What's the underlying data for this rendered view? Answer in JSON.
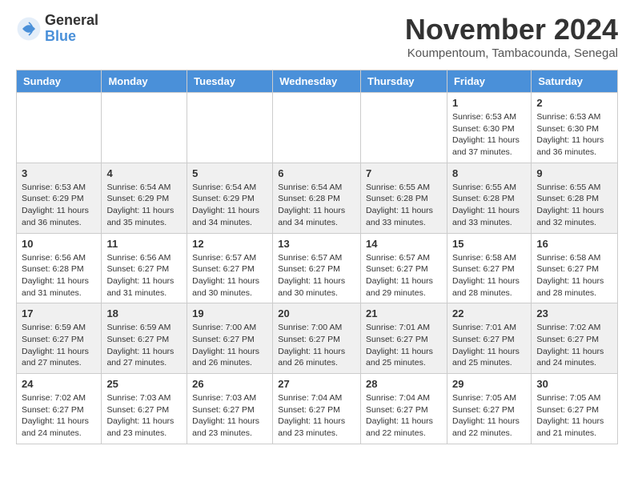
{
  "logo": {
    "general": "General",
    "blue": "Blue"
  },
  "header": {
    "month": "November 2024",
    "location": "Koumpentoum, Tambacounda, Senegal"
  },
  "weekdays": [
    "Sunday",
    "Monday",
    "Tuesday",
    "Wednesday",
    "Thursday",
    "Friday",
    "Saturday"
  ],
  "weeks": [
    [
      {
        "day": "",
        "info": ""
      },
      {
        "day": "",
        "info": ""
      },
      {
        "day": "",
        "info": ""
      },
      {
        "day": "",
        "info": ""
      },
      {
        "day": "",
        "info": ""
      },
      {
        "day": "1",
        "info": "Sunrise: 6:53 AM\nSunset: 6:30 PM\nDaylight: 11 hours and 37 minutes."
      },
      {
        "day": "2",
        "info": "Sunrise: 6:53 AM\nSunset: 6:30 PM\nDaylight: 11 hours and 36 minutes."
      }
    ],
    [
      {
        "day": "3",
        "info": "Sunrise: 6:53 AM\nSunset: 6:29 PM\nDaylight: 11 hours and 36 minutes."
      },
      {
        "day": "4",
        "info": "Sunrise: 6:54 AM\nSunset: 6:29 PM\nDaylight: 11 hours and 35 minutes."
      },
      {
        "day": "5",
        "info": "Sunrise: 6:54 AM\nSunset: 6:29 PM\nDaylight: 11 hours and 34 minutes."
      },
      {
        "day": "6",
        "info": "Sunrise: 6:54 AM\nSunset: 6:28 PM\nDaylight: 11 hours and 34 minutes."
      },
      {
        "day": "7",
        "info": "Sunrise: 6:55 AM\nSunset: 6:28 PM\nDaylight: 11 hours and 33 minutes."
      },
      {
        "day": "8",
        "info": "Sunrise: 6:55 AM\nSunset: 6:28 PM\nDaylight: 11 hours and 33 minutes."
      },
      {
        "day": "9",
        "info": "Sunrise: 6:55 AM\nSunset: 6:28 PM\nDaylight: 11 hours and 32 minutes."
      }
    ],
    [
      {
        "day": "10",
        "info": "Sunrise: 6:56 AM\nSunset: 6:28 PM\nDaylight: 11 hours and 31 minutes."
      },
      {
        "day": "11",
        "info": "Sunrise: 6:56 AM\nSunset: 6:27 PM\nDaylight: 11 hours and 31 minutes."
      },
      {
        "day": "12",
        "info": "Sunrise: 6:57 AM\nSunset: 6:27 PM\nDaylight: 11 hours and 30 minutes."
      },
      {
        "day": "13",
        "info": "Sunrise: 6:57 AM\nSunset: 6:27 PM\nDaylight: 11 hours and 30 minutes."
      },
      {
        "day": "14",
        "info": "Sunrise: 6:57 AM\nSunset: 6:27 PM\nDaylight: 11 hours and 29 minutes."
      },
      {
        "day": "15",
        "info": "Sunrise: 6:58 AM\nSunset: 6:27 PM\nDaylight: 11 hours and 28 minutes."
      },
      {
        "day": "16",
        "info": "Sunrise: 6:58 AM\nSunset: 6:27 PM\nDaylight: 11 hours and 28 minutes."
      }
    ],
    [
      {
        "day": "17",
        "info": "Sunrise: 6:59 AM\nSunset: 6:27 PM\nDaylight: 11 hours and 27 minutes."
      },
      {
        "day": "18",
        "info": "Sunrise: 6:59 AM\nSunset: 6:27 PM\nDaylight: 11 hours and 27 minutes."
      },
      {
        "day": "19",
        "info": "Sunrise: 7:00 AM\nSunset: 6:27 PM\nDaylight: 11 hours and 26 minutes."
      },
      {
        "day": "20",
        "info": "Sunrise: 7:00 AM\nSunset: 6:27 PM\nDaylight: 11 hours and 26 minutes."
      },
      {
        "day": "21",
        "info": "Sunrise: 7:01 AM\nSunset: 6:27 PM\nDaylight: 11 hours and 25 minutes."
      },
      {
        "day": "22",
        "info": "Sunrise: 7:01 AM\nSunset: 6:27 PM\nDaylight: 11 hours and 25 minutes."
      },
      {
        "day": "23",
        "info": "Sunrise: 7:02 AM\nSunset: 6:27 PM\nDaylight: 11 hours and 24 minutes."
      }
    ],
    [
      {
        "day": "24",
        "info": "Sunrise: 7:02 AM\nSunset: 6:27 PM\nDaylight: 11 hours and 24 minutes."
      },
      {
        "day": "25",
        "info": "Sunrise: 7:03 AM\nSunset: 6:27 PM\nDaylight: 11 hours and 23 minutes."
      },
      {
        "day": "26",
        "info": "Sunrise: 7:03 AM\nSunset: 6:27 PM\nDaylight: 11 hours and 23 minutes."
      },
      {
        "day": "27",
        "info": "Sunrise: 7:04 AM\nSunset: 6:27 PM\nDaylight: 11 hours and 23 minutes."
      },
      {
        "day": "28",
        "info": "Sunrise: 7:04 AM\nSunset: 6:27 PM\nDaylight: 11 hours and 22 minutes."
      },
      {
        "day": "29",
        "info": "Sunrise: 7:05 AM\nSunset: 6:27 PM\nDaylight: 11 hours and 22 minutes."
      },
      {
        "day": "30",
        "info": "Sunrise: 7:05 AM\nSunset: 6:27 PM\nDaylight: 11 hours and 21 minutes."
      }
    ]
  ],
  "colors": {
    "header_bg": "#4a90d9",
    "alt_row_bg": "#f0f4f8"
  }
}
